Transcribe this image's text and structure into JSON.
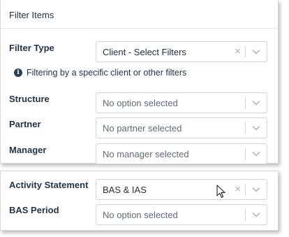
{
  "header": {
    "title": "Filter Items"
  },
  "filter_type": {
    "label": "Filter Type",
    "value": "Client - Select Filters",
    "clear_glyph": "×"
  },
  "info": {
    "icon_glyph": "i",
    "text": "Filtering by a specific client or other filters"
  },
  "structure": {
    "label": "Structure",
    "placeholder": "No option selected"
  },
  "partner": {
    "label": "Partner",
    "placeholder": "No partner selected"
  },
  "manager": {
    "label": "Manager",
    "placeholder": "No manager selected"
  },
  "activity_statement": {
    "label": "Activity Statement",
    "value": "BAS & IAS",
    "clear_glyph": "×"
  },
  "bas_period": {
    "label": "BAS Period",
    "placeholder": "No option selected"
  },
  "icons": {
    "chevron": "chevron-down-icon",
    "clear": "close-icon",
    "info": "info-icon",
    "cursor": "mouse-pointer-icon"
  },
  "colors": {
    "text_dark": "#243447",
    "placeholder": "#5f6b78",
    "border": "#cfd5db",
    "icon_grey": "#a5adb6"
  }
}
